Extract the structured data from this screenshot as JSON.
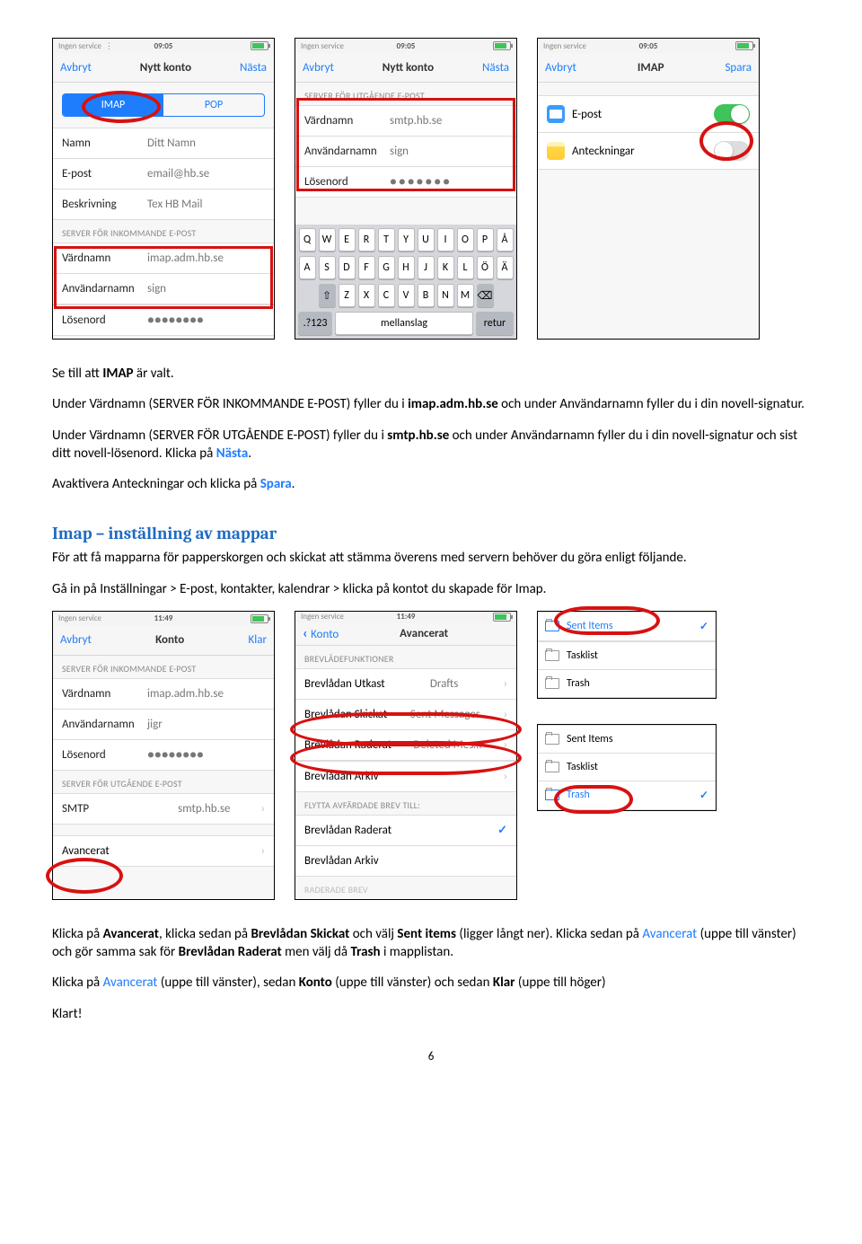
{
  "status": {
    "carrier": "Ingen service",
    "time1": "09:05",
    "time2": "11:49"
  },
  "nav": {
    "avbryt": "Avbryt",
    "nasta": "Nästa",
    "spara": "Spara",
    "klar": "Klar",
    "nyttkonto": "Nytt konto",
    "imap": "IMAP",
    "konto": "Konto",
    "avancerat": "Avancerat"
  },
  "seg": {
    "imap": "IMAP",
    "pop": "POP"
  },
  "labels": {
    "namn": "Namn",
    "epost": "E-post",
    "beskr": "Beskrivning",
    "vardnamn": "Värdnamn",
    "anvandarnamn": "Användarnamn",
    "losenord": "Lösenord",
    "smtp": "SMTP",
    "avancerat": "Avancerat",
    "epost_item": "E-post",
    "anteck": "Anteckningar"
  },
  "values": {
    "namn": "Ditt Namn",
    "epost": "email@hb.se",
    "beskr": "Tex HB Mail",
    "inhost": "imap.adm.hb.se",
    "outhost": "smtp.hb.se",
    "user": "sign",
    "user2": "jigr",
    "pwd": "●●●●●●●●",
    "smtpval": "smtp.hb.se"
  },
  "sections": {
    "inkommande": "SERVER FÖR INKOMMANDE E-POST",
    "utgaende": "SERVER FÖR UTGÅENDE E-POST",
    "brevlade": "BREVLÅDEFUNKTIONER",
    "flytta": "FLYTTA AVFÄRDADE BREV TILL:",
    "raderade": "RADERADE BREV"
  },
  "adv": {
    "utkast": "Brevlådan Utkast",
    "utkast_v": "Drafts",
    "skickat": "Brevlådan Skickat",
    "skickat_v": "Sent Messages",
    "raderat": "Brevlådan Raderat",
    "raderat_v": "Deleted Mes…",
    "arkiv": "Brevlådan Arkiv"
  },
  "folders": {
    "sent": "Sent Items",
    "tasklist": "Tasklist",
    "trash": "Trash"
  },
  "keyboard": {
    "r1": [
      "Q",
      "W",
      "E",
      "R",
      "T",
      "Y",
      "U",
      "I",
      "O",
      "P",
      "Å"
    ],
    "r2": [
      "A",
      "S",
      "D",
      "F",
      "G",
      "H",
      "J",
      "K",
      "L",
      "Ö",
      "Ä"
    ],
    "r3": [
      "Z",
      "X",
      "C",
      "V",
      "B",
      "N",
      "M"
    ],
    "shift": "⇧",
    "bksp": "⌫",
    "num": ".?123",
    "space": "mellanslag",
    "ret": "retur"
  },
  "text": {
    "p1a": "Se till att ",
    "p1b": "IMAP",
    "p1c": " är valt.",
    "p2a": "Under Värdnamn (SERVER FÖR INKOMMANDE E-POST) fyller du i ",
    "p2b": "imap.adm.hb.se",
    "p2c": " och under Användarnamn fyller du i din novell-signatur.",
    "p3a": "Under Värdnamn (SERVER FÖR UTGÅENDE E-POST) fyller du i ",
    "p3b": "smtp.hb.se",
    "p3c": " och under Användarnamn fyller du i din novell-signatur och sist ditt novell-lösenord. Klicka på ",
    "p3d": "Nästa",
    "p3e": ".",
    "p4a": "Avaktivera Anteckningar och klicka på ",
    "p4b": "Spara",
    "p4c": ".",
    "h2": "Imap – inställning av mappar",
    "p5": "För att få mapparna för papperskorgen och skickat att stämma överens med servern behöver du göra enligt följande.",
    "p6": "Gå in på Inställningar > E-post, kontakter, kalendrar > klicka på kontot du skapade för Imap.",
    "p7a": "Klicka på ",
    "p7b": "Avancerat",
    "p7c": ", klicka sedan på ",
    "p7d": "Brevlådan Skickat",
    "p7e": " och välj ",
    "p7f": "Sent items",
    "p7g": " (ligger långt ner). Klicka sedan på ",
    "p7h": "Avancerat",
    "p7i": " (uppe till vänster) och gör samma sak för ",
    "p7j": "Brevlådan Raderat",
    "p7k": " men välj då ",
    "p7l": "Trash",
    "p7m": " i mapplistan.",
    "p8a": "Klicka på ",
    "p8b": "Avancerat",
    "p8c": " (uppe till vänster), sedan ",
    "p8d": "Konto",
    "p8e": " (uppe till vänster) och sedan ",
    "p8f": "Klar",
    "p8g": " (uppe till höger)",
    "p9": "Klart!",
    "pagenum": "6"
  }
}
